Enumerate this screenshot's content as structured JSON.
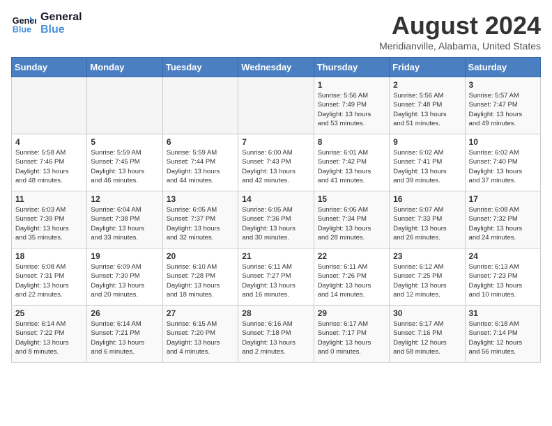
{
  "header": {
    "logo_line1": "General",
    "logo_line2": "Blue",
    "month_year": "August 2024",
    "location": "Meridianville, Alabama, United States"
  },
  "weekdays": [
    "Sunday",
    "Monday",
    "Tuesday",
    "Wednesday",
    "Thursday",
    "Friday",
    "Saturday"
  ],
  "weeks": [
    [
      {
        "day": "",
        "info": ""
      },
      {
        "day": "",
        "info": ""
      },
      {
        "day": "",
        "info": ""
      },
      {
        "day": "",
        "info": ""
      },
      {
        "day": "1",
        "info": "Sunrise: 5:56 AM\nSunset: 7:49 PM\nDaylight: 13 hours\nand 53 minutes."
      },
      {
        "day": "2",
        "info": "Sunrise: 5:56 AM\nSunset: 7:48 PM\nDaylight: 13 hours\nand 51 minutes."
      },
      {
        "day": "3",
        "info": "Sunrise: 5:57 AM\nSunset: 7:47 PM\nDaylight: 13 hours\nand 49 minutes."
      }
    ],
    [
      {
        "day": "4",
        "info": "Sunrise: 5:58 AM\nSunset: 7:46 PM\nDaylight: 13 hours\nand 48 minutes."
      },
      {
        "day": "5",
        "info": "Sunrise: 5:59 AM\nSunset: 7:45 PM\nDaylight: 13 hours\nand 46 minutes."
      },
      {
        "day": "6",
        "info": "Sunrise: 5:59 AM\nSunset: 7:44 PM\nDaylight: 13 hours\nand 44 minutes."
      },
      {
        "day": "7",
        "info": "Sunrise: 6:00 AM\nSunset: 7:43 PM\nDaylight: 13 hours\nand 42 minutes."
      },
      {
        "day": "8",
        "info": "Sunrise: 6:01 AM\nSunset: 7:42 PM\nDaylight: 13 hours\nand 41 minutes."
      },
      {
        "day": "9",
        "info": "Sunrise: 6:02 AM\nSunset: 7:41 PM\nDaylight: 13 hours\nand 39 minutes."
      },
      {
        "day": "10",
        "info": "Sunrise: 6:02 AM\nSunset: 7:40 PM\nDaylight: 13 hours\nand 37 minutes."
      }
    ],
    [
      {
        "day": "11",
        "info": "Sunrise: 6:03 AM\nSunset: 7:39 PM\nDaylight: 13 hours\nand 35 minutes."
      },
      {
        "day": "12",
        "info": "Sunrise: 6:04 AM\nSunset: 7:38 PM\nDaylight: 13 hours\nand 33 minutes."
      },
      {
        "day": "13",
        "info": "Sunrise: 6:05 AM\nSunset: 7:37 PM\nDaylight: 13 hours\nand 32 minutes."
      },
      {
        "day": "14",
        "info": "Sunrise: 6:05 AM\nSunset: 7:36 PM\nDaylight: 13 hours\nand 30 minutes."
      },
      {
        "day": "15",
        "info": "Sunrise: 6:06 AM\nSunset: 7:34 PM\nDaylight: 13 hours\nand 28 minutes."
      },
      {
        "day": "16",
        "info": "Sunrise: 6:07 AM\nSunset: 7:33 PM\nDaylight: 13 hours\nand 26 minutes."
      },
      {
        "day": "17",
        "info": "Sunrise: 6:08 AM\nSunset: 7:32 PM\nDaylight: 13 hours\nand 24 minutes."
      }
    ],
    [
      {
        "day": "18",
        "info": "Sunrise: 6:08 AM\nSunset: 7:31 PM\nDaylight: 13 hours\nand 22 minutes."
      },
      {
        "day": "19",
        "info": "Sunrise: 6:09 AM\nSunset: 7:30 PM\nDaylight: 13 hours\nand 20 minutes."
      },
      {
        "day": "20",
        "info": "Sunrise: 6:10 AM\nSunset: 7:28 PM\nDaylight: 13 hours\nand 18 minutes."
      },
      {
        "day": "21",
        "info": "Sunrise: 6:11 AM\nSunset: 7:27 PM\nDaylight: 13 hours\nand 16 minutes."
      },
      {
        "day": "22",
        "info": "Sunrise: 6:11 AM\nSunset: 7:26 PM\nDaylight: 13 hours\nand 14 minutes."
      },
      {
        "day": "23",
        "info": "Sunrise: 6:12 AM\nSunset: 7:25 PM\nDaylight: 13 hours\nand 12 minutes."
      },
      {
        "day": "24",
        "info": "Sunrise: 6:13 AM\nSunset: 7:23 PM\nDaylight: 13 hours\nand 10 minutes."
      }
    ],
    [
      {
        "day": "25",
        "info": "Sunrise: 6:14 AM\nSunset: 7:22 PM\nDaylight: 13 hours\nand 8 minutes."
      },
      {
        "day": "26",
        "info": "Sunrise: 6:14 AM\nSunset: 7:21 PM\nDaylight: 13 hours\nand 6 minutes."
      },
      {
        "day": "27",
        "info": "Sunrise: 6:15 AM\nSunset: 7:20 PM\nDaylight: 13 hours\nand 4 minutes."
      },
      {
        "day": "28",
        "info": "Sunrise: 6:16 AM\nSunset: 7:18 PM\nDaylight: 13 hours\nand 2 minutes."
      },
      {
        "day": "29",
        "info": "Sunrise: 6:17 AM\nSunset: 7:17 PM\nDaylight: 13 hours\nand 0 minutes."
      },
      {
        "day": "30",
        "info": "Sunrise: 6:17 AM\nSunset: 7:16 PM\nDaylight: 12 hours\nand 58 minutes."
      },
      {
        "day": "31",
        "info": "Sunrise: 6:18 AM\nSunset: 7:14 PM\nDaylight: 12 hours\nand 56 minutes."
      }
    ]
  ]
}
